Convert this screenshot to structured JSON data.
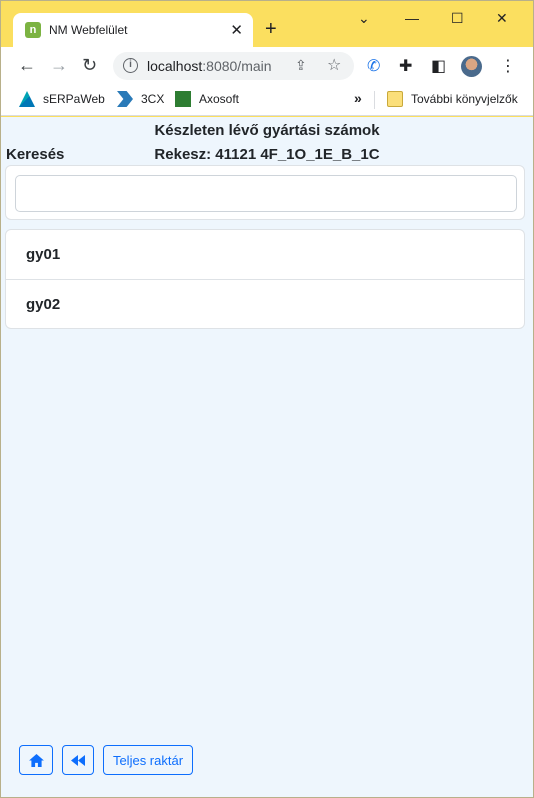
{
  "browser": {
    "tab_title": "NM Webfelület",
    "tab_favicon_letter": "n",
    "new_tab": "+",
    "url_host": "localhost",
    "url_rest": ":8080/main",
    "bookmarks": [
      "sERPaWeb",
      "3CX",
      "Axosoft"
    ],
    "bookmarks_more": "»",
    "other_bookmarks": "További könyvjelzők"
  },
  "page": {
    "title": "Készleten lévő gyártási számok",
    "subtitle": "Rekesz: 41121 4F_1O_1E_B_1C",
    "search_label": "Keresés",
    "search_value": "",
    "items": [
      "gy01",
      "gy02"
    ],
    "buttons": {
      "full_stock": "Teljes raktár"
    }
  },
  "colors": {
    "titlebar": "#fbdf5f",
    "page_bg": "#eef6fd",
    "accent": "#0d6efd"
  }
}
